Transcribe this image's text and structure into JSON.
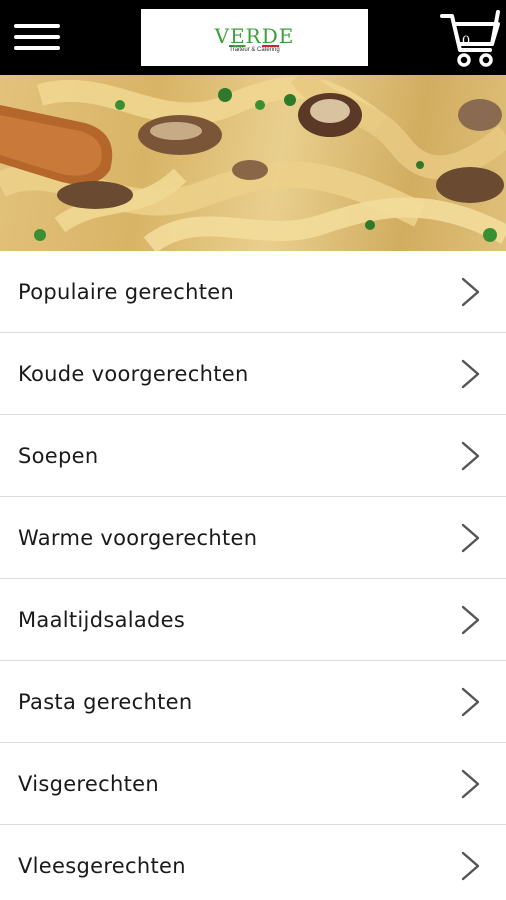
{
  "header": {
    "menu_icon": "hamburger-menu-icon",
    "logo": {
      "name": "VERDE",
      "tagline": "Traiteur & Catering"
    },
    "cart": {
      "icon": "shopping-cart-icon",
      "count": "0"
    },
    "colors": {
      "bar": "#000000",
      "logo_green": "#3aa13a",
      "logo_red": "#d2232a"
    }
  },
  "hero": {
    "image": "pasta-mushroom-dish-photo"
  },
  "categories": [
    {
      "label": "Populaire gerechten"
    },
    {
      "label": "Koude voorgerechten"
    },
    {
      "label": "Soepen"
    },
    {
      "label": "Warme voorgerechten"
    },
    {
      "label": "Maaltijdsalades"
    },
    {
      "label": "Pasta gerechten"
    },
    {
      "label": "Visgerechten"
    },
    {
      "label": "Vleesgerechten"
    }
  ],
  "item_icon": "chevron-right-icon"
}
